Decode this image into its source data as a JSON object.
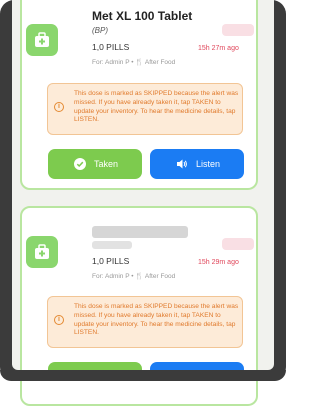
{
  "cards": [
    {
      "medicine_name": "Met XL 100 Tablet",
      "subtitle": "(BP)",
      "quantity": "1,0 PILLS",
      "for_label": "For: Admin P",
      "timing": "After Food",
      "ago": "15h 27m ago",
      "notice": "This dose is marked as SKIPPED because the alert was missed. If you have already taken it, tap TAKEN to update your inventory. To hear the medicine details, tap LISTEN.",
      "taken_label": "Taken",
      "listen_label": "Listen"
    },
    {
      "quantity": "1,0 PILLS",
      "for_label": "For: Admin P",
      "timing": "After Food",
      "ago": "15h 29m ago",
      "notice": "This dose is marked as SKIPPED because the alert was missed. If you have already taken it, tap TAKEN to update your inventory. To hear the medicine details, tap LISTEN."
    }
  ],
  "colors": {
    "accent_green": "#7dcb4e",
    "listen_blue": "#1b7cf3",
    "warning_orange": "#e07a2c",
    "time_red": "#e0475b"
  },
  "icons": [
    "medicine-kit-icon",
    "check-circle-icon",
    "speaker-icon",
    "info-icon",
    "fork-knife-icon"
  ]
}
